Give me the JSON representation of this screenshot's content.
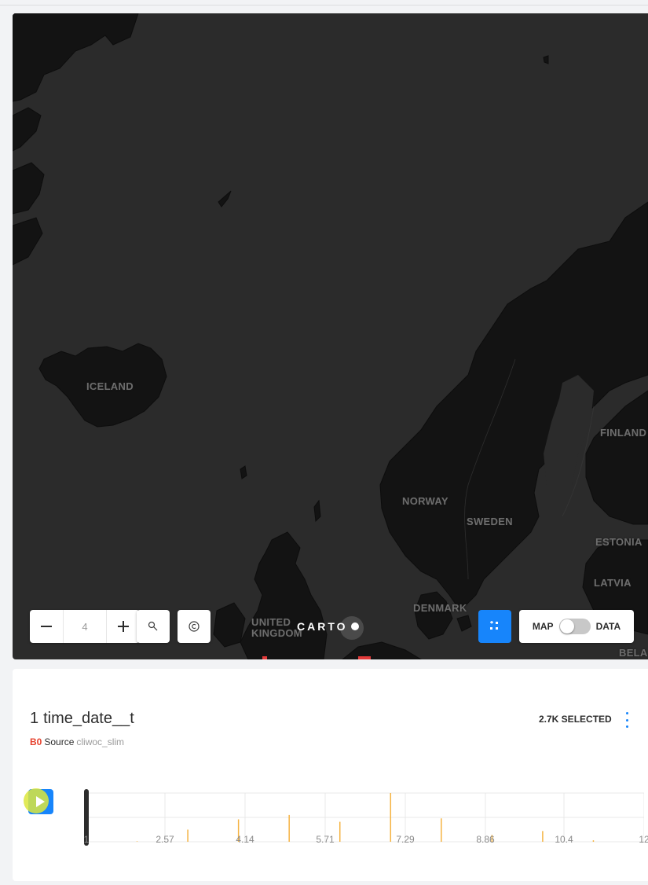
{
  "map": {
    "labels": [
      "ICELAND",
      "NORWAY",
      "SWEDEN",
      "FINLAND",
      "ESTONIA",
      "LATVIA",
      "DENMARK",
      "UNITED KINGDOM",
      "BELA"
    ],
    "zoom_level": "4",
    "zoom_out_icon": "minus-icon",
    "zoom_in_icon": "plus-icon",
    "search_icon": "search-icon",
    "attribution_icon": "copyright-icon",
    "brand": "CARTO",
    "widgets_icon": "widgets-icon",
    "toggle": {
      "left_label": "MAP",
      "right_label": "DATA",
      "state": "map"
    },
    "colors": {
      "water": "#2b2b2b",
      "land": "#141414",
      "accent": "#1785fb"
    }
  },
  "widget": {
    "index": "1",
    "title": "time_date__t",
    "layer": "B0",
    "source_label": "Source",
    "source_name": "cliwoc_slim",
    "selected": "2.7K SELECTED",
    "menu_icon": "more-vertical-icon",
    "play_icon": "play-icon"
  },
  "chart_data": {
    "type": "bar",
    "title": "",
    "xlabel": "",
    "ylabel": "",
    "xlim": [
      1,
      12
    ],
    "x_ticks": [
      "1",
      "2.57",
      "4.14",
      "5.71",
      "7.29",
      "8.86",
      "10.4",
      "12"
    ],
    "x": [
      2,
      3,
      4,
      5,
      6,
      7,
      8,
      9,
      10,
      11
    ],
    "values": [
      1,
      25,
      46,
      55,
      41,
      100,
      48,
      14,
      22,
      3
    ],
    "bar_color": "#f5b342",
    "grid": true
  }
}
